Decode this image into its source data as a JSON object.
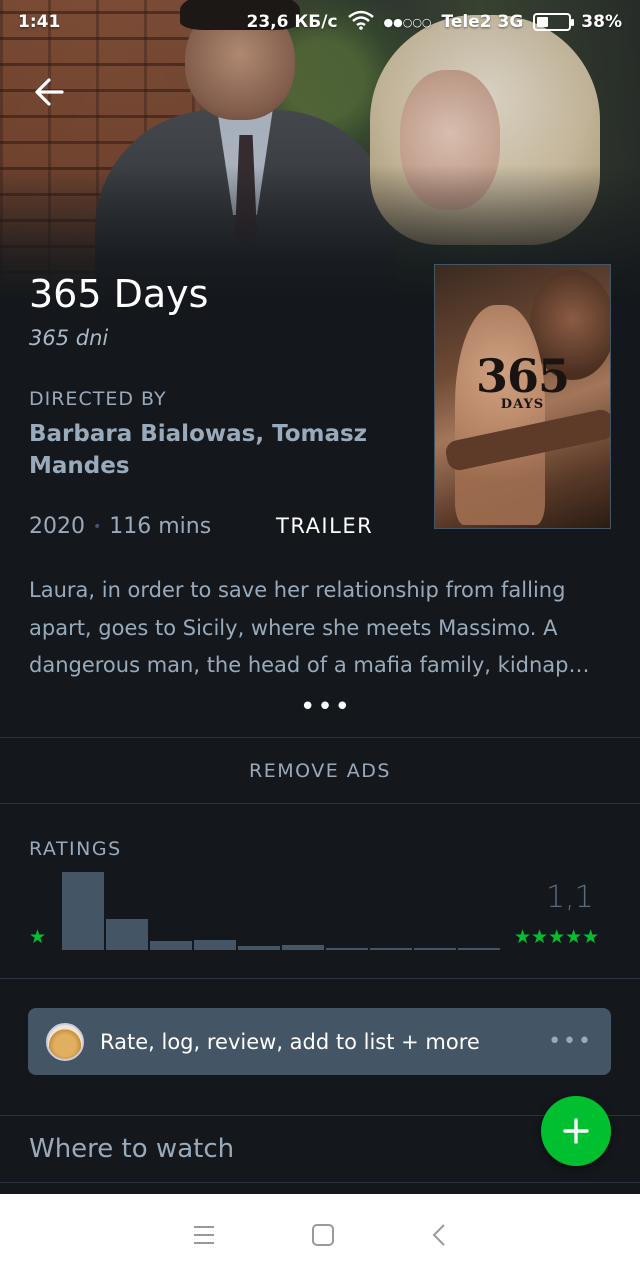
{
  "status_bar": {
    "time": "1:41",
    "network_speed": "23,6 КБ/с",
    "carrier": "Tele2 3G",
    "battery_percent": "38%",
    "battery_level": 0.38
  },
  "film": {
    "title": "365 Days",
    "original_title": "365 dni",
    "directed_by_label": "DIRECTED BY",
    "directors": "Barbara Bialowas, Tomasz Mandes",
    "year": "2020",
    "runtime": "116 mins",
    "trailer_label": "TRAILER",
    "poster": {
      "number_text": "365",
      "days_text": "DAYS"
    },
    "synopsis": "Laura, in order to save her relationship from falling apart, goes to Sicily, where she meets Massimo. A dangerous man, the head of a mafia family, kidnap…",
    "more_icon": "more-dots-icon"
  },
  "ads": {
    "remove_label": "REMOVE ADS"
  },
  "ratings": {
    "label": "RATINGS",
    "average": "1,1",
    "min_stars": "★",
    "max_stars": "★★★★★",
    "histogram": [
      0.95,
      0.38,
      0.11,
      0.12,
      0.05,
      0.06,
      0.02,
      0.03,
      0.01,
      0.03
    ],
    "star_color": "#00c030",
    "bar_color": "#445566"
  },
  "actions": {
    "label": "Rate, log, review, add to list + more",
    "avatar_icon": "user-avatar",
    "more_icon": "more-dots-icon"
  },
  "where_to_watch": {
    "label": "Where to watch"
  },
  "fab": {
    "icon": "plus-icon",
    "color": "#00c030"
  },
  "nav": {
    "menu_icon": "menu-icon",
    "home_icon": "home-square-icon",
    "back_icon": "back-chevron-icon"
  },
  "colors": {
    "background": "#14181c",
    "secondary_text": "#99aabb",
    "accent": "#00c030"
  }
}
